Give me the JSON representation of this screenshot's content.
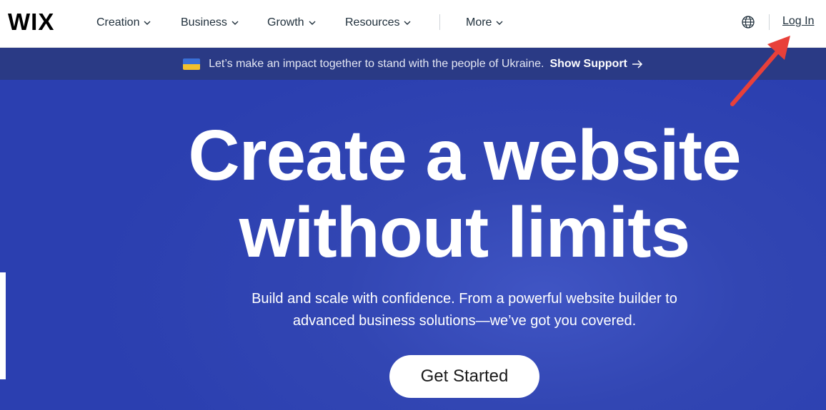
{
  "header": {
    "logo": "WIX",
    "nav": [
      {
        "label": "Creation"
      },
      {
        "label": "Business"
      },
      {
        "label": "Growth"
      },
      {
        "label": "Resources"
      },
      {
        "label": "More"
      }
    ],
    "globe_icon": "globe-icon",
    "login_label": "Log In"
  },
  "banner": {
    "flag_icon": "ukraine-flag-icon",
    "text": "Let’s make an impact together to stand with the people of Ukraine.",
    "link_label": "Show Support",
    "arrow_icon": "arrow-right-icon"
  },
  "hero": {
    "title_line1": "Create a website",
    "title_line2": "without limits",
    "subtitle_line1": "Build and scale with confidence. From a powerful website builder to",
    "subtitle_line2": "advanced business solutions—we’ve got you covered.",
    "cta_label": "Get Started"
  },
  "colors": {
    "banner_bg": "#2a3a85",
    "hero_bg": "#3246b3",
    "annotation_arrow": "#e8403a"
  }
}
